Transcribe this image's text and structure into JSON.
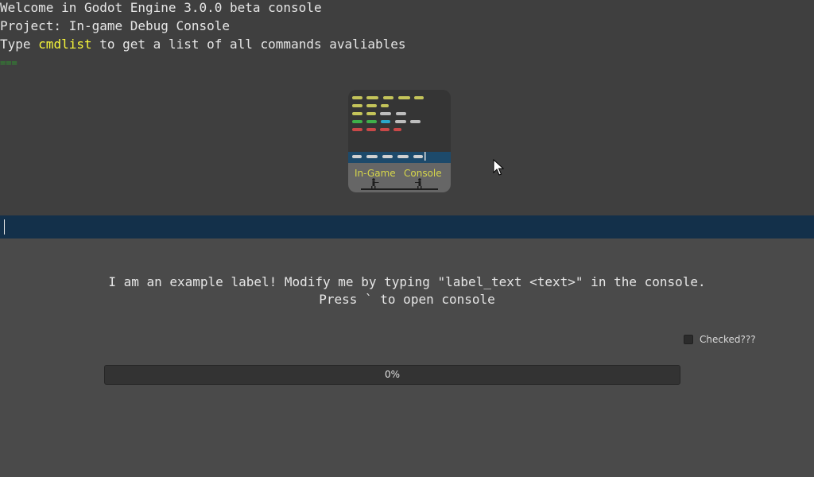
{
  "console": {
    "line1": "Welcome in Godot Engine 3.0.0 beta console",
    "line2": "Project: In-game Debug Console",
    "line3_before": "Type ",
    "line3_command": "cmdlist",
    "line3_after": " to get a list of all commands avaliables",
    "separator": "===",
    "input_value": ""
  },
  "logo": {
    "icon": "in-game-console-logo",
    "text_left": "In-Game",
    "text_right": "Console"
  },
  "example": {
    "label_line1": "I am an example label! Modify me by typing \"label_text <text>\" in the console.",
    "label_line2": "Press ` to open console"
  },
  "checkbox": {
    "label": "Checked???",
    "checked": false
  },
  "progress": {
    "value": 0,
    "text": "0%"
  },
  "colors": {
    "background": "#4a4a4a",
    "console_bg": "#3f3f3f",
    "input_bg": "#13304a",
    "command_highlight": "#f5f53a",
    "separator": "#2e9e2e"
  }
}
